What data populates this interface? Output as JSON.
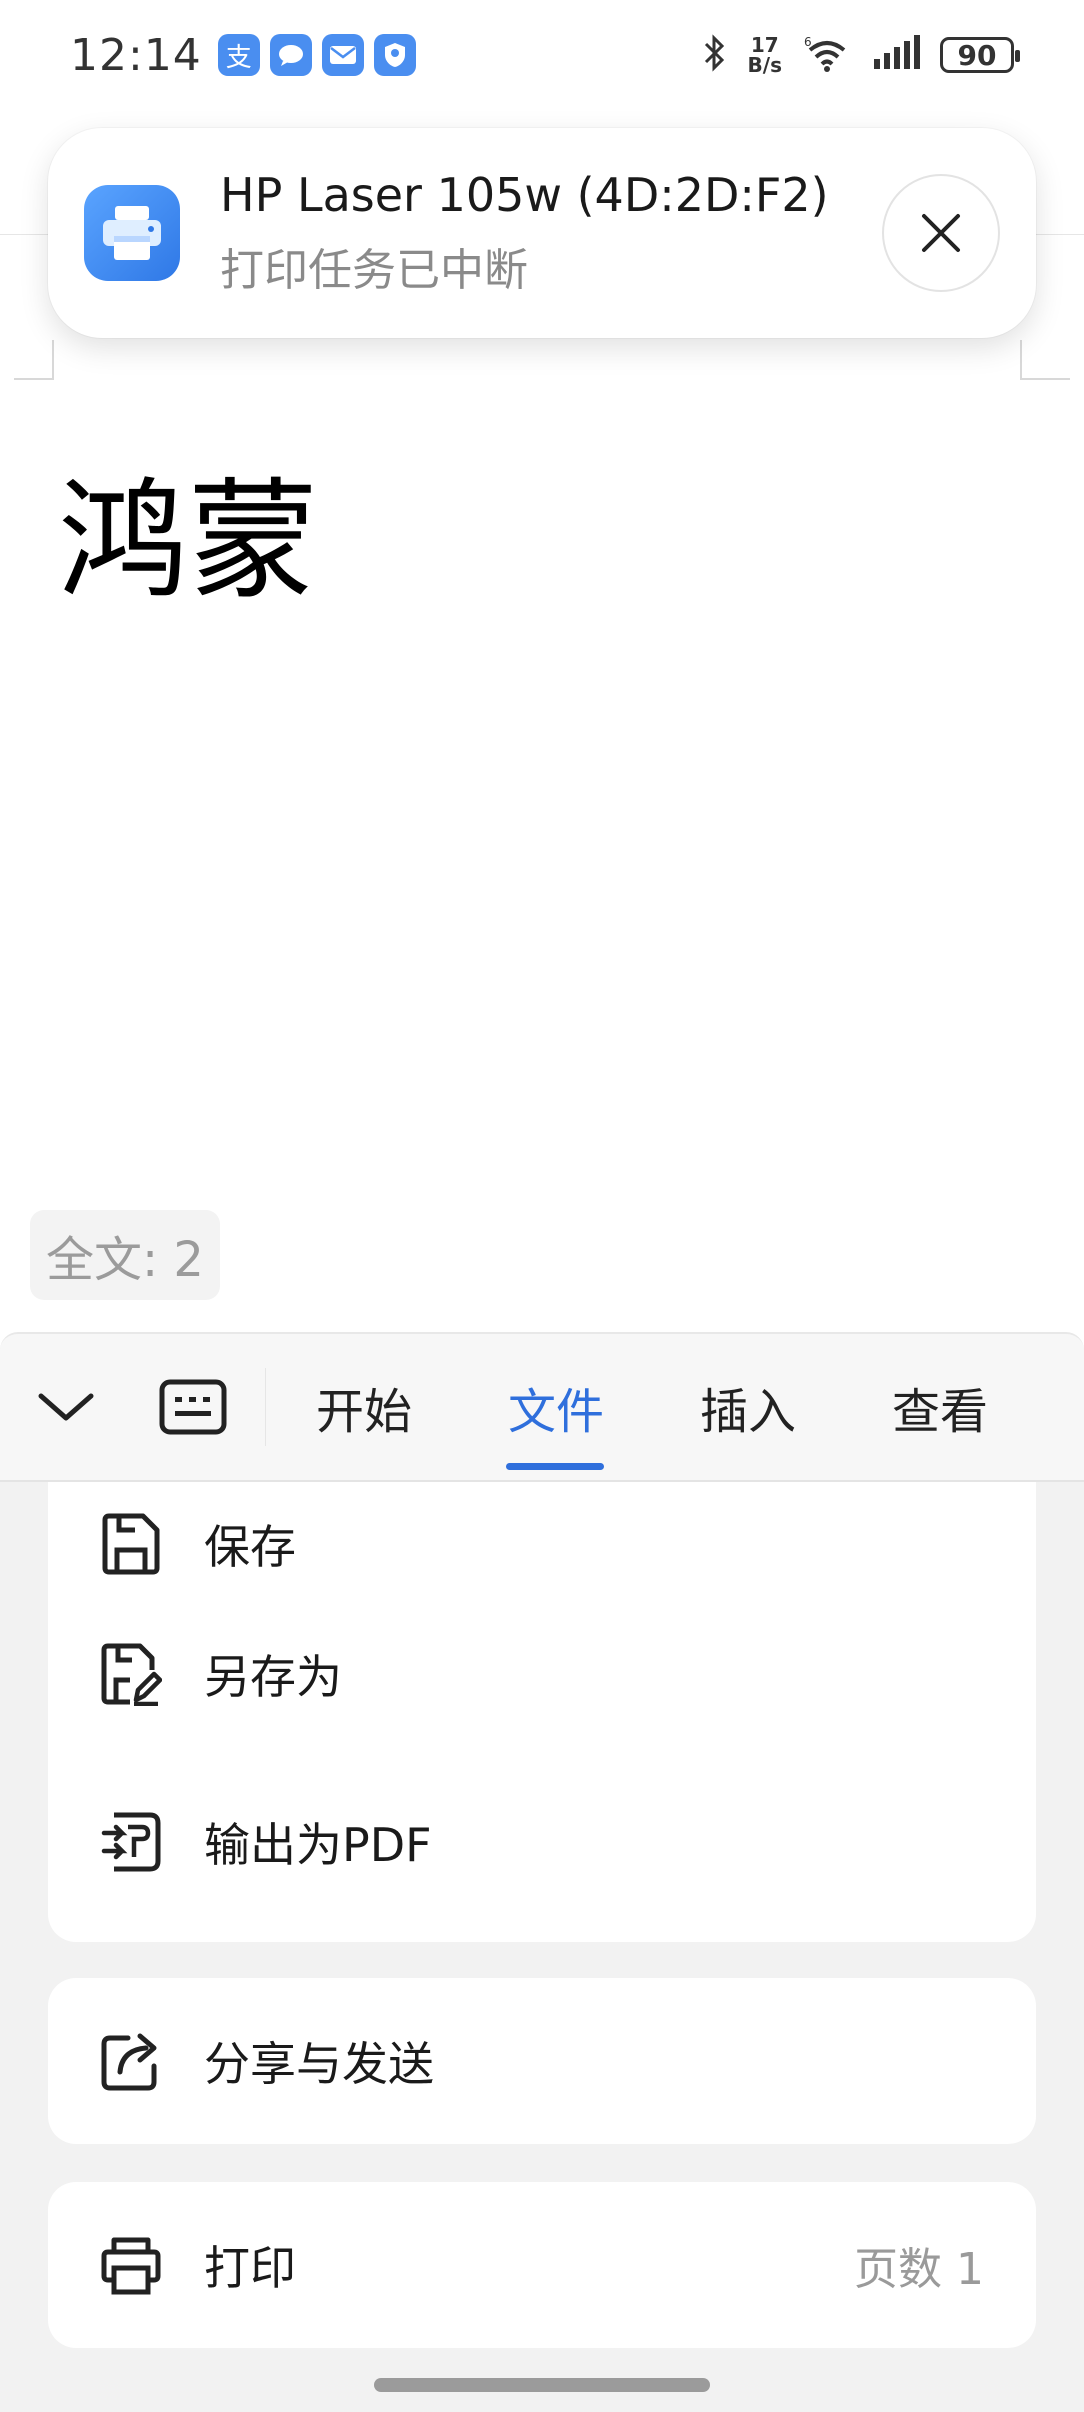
{
  "status_bar": {
    "time": "12:14",
    "app_icons": [
      "支",
      "💬",
      "✉",
      "👤"
    ],
    "net_speed_value": "17",
    "net_speed_unit": "B/s",
    "battery": "90"
  },
  "notification": {
    "title": "HP Laser 105w (4D:2D:F2)",
    "subtitle": "打印任务已中断",
    "icon": "printer-icon"
  },
  "document": {
    "text": "鸿蒙",
    "word_count": "全文: 2"
  },
  "toolbar": {
    "tabs": [
      {
        "label": "开始",
        "active": false
      },
      {
        "label": "文件",
        "active": true
      },
      {
        "label": "插入",
        "active": false
      },
      {
        "label": "查看",
        "active": false
      }
    ],
    "accent": "#2f6fdc"
  },
  "file_menu": {
    "save_label": "保存",
    "save_as_label": "另存为",
    "export_pdf_label": "输出为PDF",
    "share_label": "分享与发送",
    "print_label": "打印",
    "page_count": "页数 1"
  }
}
